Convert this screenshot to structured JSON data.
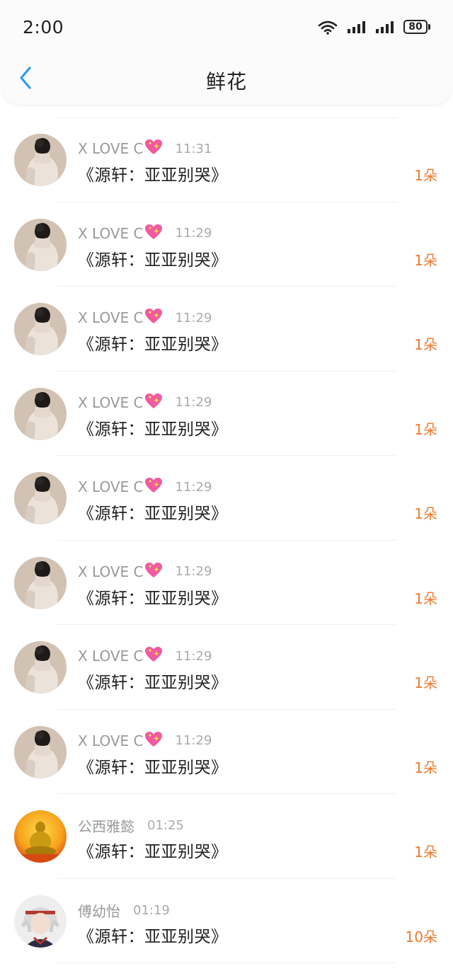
{
  "status_bar": {
    "time": "2:00",
    "battery": "80",
    "wifi_label": "6",
    "icons": [
      "wifi-icon",
      "signal-icon",
      "signal-icon",
      "battery-icon"
    ]
  },
  "header": {
    "title": "鲜花",
    "back_icon": "chevron-left-icon"
  },
  "colors": {
    "accent": "#2b9bf4",
    "count": "#ef7a2e",
    "muted": "#999999"
  },
  "items": [
    {
      "user": "X LOVE C",
      "emoji": "sparkling-heart-icon",
      "time": "11:31",
      "content": "《源轩：亚亚别哭》",
      "count": "1朵",
      "avatar": "woman-photo"
    },
    {
      "user": "X LOVE C",
      "emoji": "sparkling-heart-icon",
      "time": "11:29",
      "content": "《源轩：亚亚别哭》",
      "count": "1朵",
      "avatar": "woman-photo"
    },
    {
      "user": "X LOVE C",
      "emoji": "sparkling-heart-icon",
      "time": "11:29",
      "content": "《源轩：亚亚别哭》",
      "count": "1朵",
      "avatar": "woman-photo"
    },
    {
      "user": "X LOVE C",
      "emoji": "sparkling-heart-icon",
      "time": "11:29",
      "content": "《源轩：亚亚别哭》",
      "count": "1朵",
      "avatar": "woman-photo"
    },
    {
      "user": "X LOVE C",
      "emoji": "sparkling-heart-icon",
      "time": "11:29",
      "content": "《源轩：亚亚别哭》",
      "count": "1朵",
      "avatar": "woman-photo"
    },
    {
      "user": "X LOVE C",
      "emoji": "sparkling-heart-icon",
      "time": "11:29",
      "content": "《源轩：亚亚别哭》",
      "count": "1朵",
      "avatar": "woman-photo"
    },
    {
      "user": "X LOVE C",
      "emoji": "sparkling-heart-icon",
      "time": "11:29",
      "content": "《源轩：亚亚别哭》",
      "count": "1朵",
      "avatar": "woman-photo"
    },
    {
      "user": "X LOVE C",
      "emoji": "sparkling-heart-icon",
      "time": "11:29",
      "content": "《源轩：亚亚别哭》",
      "count": "1朵",
      "avatar": "woman-photo"
    },
    {
      "user": "公西雅懿",
      "emoji": "",
      "time": "01:25",
      "content": "《源轩：亚亚别哭》",
      "count": "1朵",
      "avatar": "golden-buddha"
    },
    {
      "user": "傅幼怡",
      "emoji": "",
      "time": "01:19",
      "content": "《源轩：亚亚别哭》",
      "count": "10朵",
      "avatar": "anime-character"
    }
  ]
}
